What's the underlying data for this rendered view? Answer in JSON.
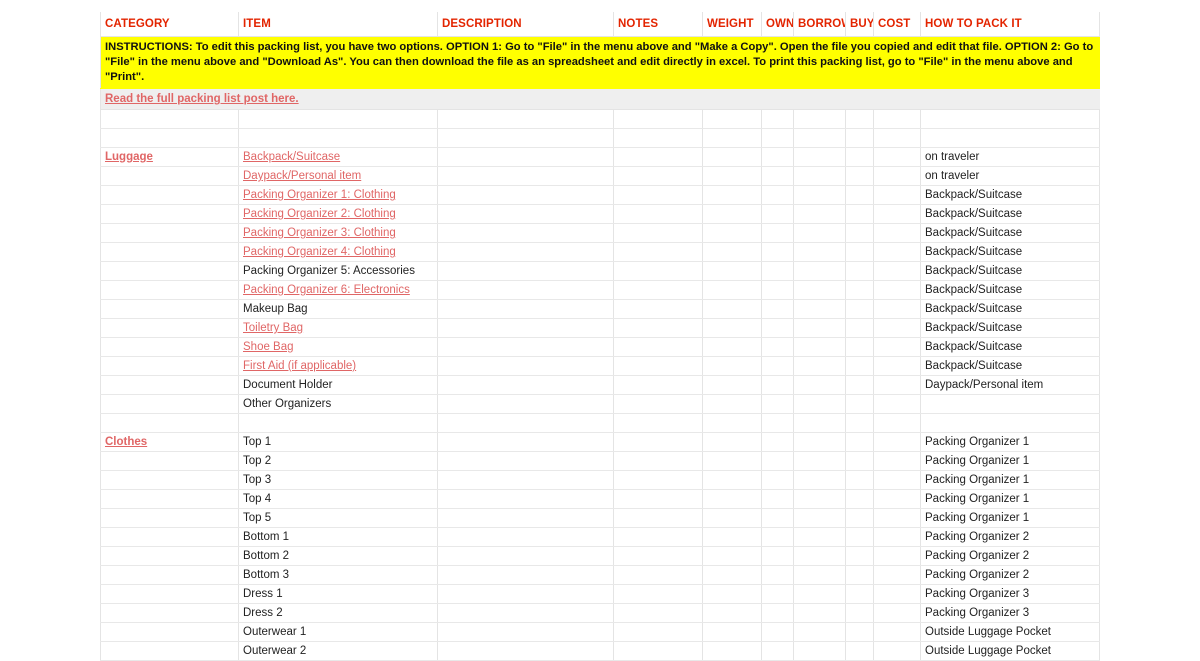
{
  "columns": [
    {
      "key": "category",
      "label": "CATEGORY"
    },
    {
      "key": "item",
      "label": "ITEM"
    },
    {
      "key": "description",
      "label": "DESCRIPTION"
    },
    {
      "key": "notes",
      "label": "NOTES"
    },
    {
      "key": "weight",
      "label": "WEIGHT"
    },
    {
      "key": "own",
      "label": "OWN"
    },
    {
      "key": "borrow",
      "label": "BORROW"
    },
    {
      "key": "buy",
      "label": "BUY"
    },
    {
      "key": "cost",
      "label": "COST"
    },
    {
      "key": "howto",
      "label": "HOW TO PACK IT"
    }
  ],
  "banner": {
    "instructions": "INSTRUCTIONS: To edit this packing list, you have two options. OPTION 1: Go to \"File\" in the menu above and \"Make a Copy\". Open the file you copied and edit that file. OPTION 2: Go to \"File\" in the menu above and \"Download As\". You can then download the file as an spreadsheet and edit directly in excel. To print this packing list, go to \"File\" in the menu above and \"Print\".",
    "read_post_link": "Read the full packing list post here."
  },
  "colors": {
    "header_red": "#e32400",
    "link_red": "#e06666",
    "banner_yellow": "#ffff00",
    "readpost_gray": "#efefef",
    "grid_line": "#e4e4e4"
  },
  "rows": [
    {
      "type": "blank"
    },
    {
      "type": "blank"
    },
    {
      "type": "data",
      "category": "Luggage",
      "category_style": "link",
      "item": "Backpack/Suitcase",
      "item_style": "link",
      "howto": "on traveler"
    },
    {
      "type": "data",
      "category": "",
      "item": "Daypack/Personal item",
      "item_style": "link",
      "howto": "on traveler"
    },
    {
      "type": "data",
      "category": "",
      "item": "Packing Organizer 1: Clothing",
      "item_style": "link",
      "howto": "Backpack/Suitcase"
    },
    {
      "type": "data",
      "category": "",
      "item": "Packing Organizer 2: Clothing",
      "item_style": "link",
      "howto": "Backpack/Suitcase"
    },
    {
      "type": "data",
      "category": "",
      "item": "Packing Organizer 3: Clothing",
      "item_style": "link",
      "howto": "Backpack/Suitcase"
    },
    {
      "type": "data",
      "category": "",
      "item": "Packing Organizer 4: Clothing",
      "item_style": "link",
      "howto": "Backpack/Suitcase"
    },
    {
      "type": "data",
      "category": "",
      "item": "Packing Organizer 5: Accessories",
      "item_style": "plain",
      "howto": "Backpack/Suitcase"
    },
    {
      "type": "data",
      "category": "",
      "item": "Packing Organizer 6: Electronics",
      "item_style": "link",
      "howto": "Backpack/Suitcase"
    },
    {
      "type": "data",
      "category": "",
      "item": "Makeup Bag",
      "item_style": "plain",
      "howto": "Backpack/Suitcase"
    },
    {
      "type": "data",
      "category": "",
      "item": "Toiletry Bag",
      "item_style": "link",
      "howto": "Backpack/Suitcase"
    },
    {
      "type": "data",
      "category": "",
      "item": "Shoe Bag",
      "item_style": "link",
      "howto": "Backpack/Suitcase"
    },
    {
      "type": "data",
      "category": "",
      "item": "First Aid (if applicable)",
      "item_style": "link",
      "howto": "Backpack/Suitcase"
    },
    {
      "type": "data",
      "category": "",
      "item": "Document Holder",
      "item_style": "plain",
      "howto": "Daypack/Personal item"
    },
    {
      "type": "data",
      "category": "",
      "item": "Other Organizers",
      "item_style": "plain",
      "howto": ""
    },
    {
      "type": "blank"
    },
    {
      "type": "data",
      "category": "Clothes",
      "category_style": "link",
      "item": "Top 1",
      "item_style": "plain",
      "howto": "Packing Organizer 1"
    },
    {
      "type": "data",
      "category": "",
      "item": "Top 2",
      "item_style": "plain",
      "howto": "Packing Organizer 1"
    },
    {
      "type": "data",
      "category": "",
      "item": "Top 3",
      "item_style": "plain",
      "howto": "Packing Organizer 1"
    },
    {
      "type": "data",
      "category": "",
      "item": "Top 4",
      "item_style": "plain",
      "howto": "Packing Organizer 1"
    },
    {
      "type": "data",
      "category": "",
      "item": "Top 5",
      "item_style": "plain",
      "howto": "Packing Organizer 1"
    },
    {
      "type": "data",
      "category": "",
      "item": "Bottom 1",
      "item_style": "plain",
      "howto": "Packing Organizer 2"
    },
    {
      "type": "data",
      "category": "",
      "item": "Bottom 2",
      "item_style": "plain",
      "howto": "Packing Organizer 2"
    },
    {
      "type": "data",
      "category": "",
      "item": "Bottom 3",
      "item_style": "plain",
      "howto": "Packing Organizer 2"
    },
    {
      "type": "data",
      "category": "",
      "item": "Dress 1",
      "item_style": "plain",
      "howto": "Packing Organizer 3"
    },
    {
      "type": "data",
      "category": "",
      "item": "Dress 2",
      "item_style": "plain",
      "howto": "Packing Organizer 3"
    },
    {
      "type": "data",
      "category": "",
      "item": "Outerwear 1",
      "item_style": "plain",
      "howto": "Outside Luggage Pocket"
    },
    {
      "type": "data",
      "category": "",
      "item": "Outerwear 2",
      "item_style": "plain",
      "howto": "Outside Luggage Pocket"
    }
  ]
}
